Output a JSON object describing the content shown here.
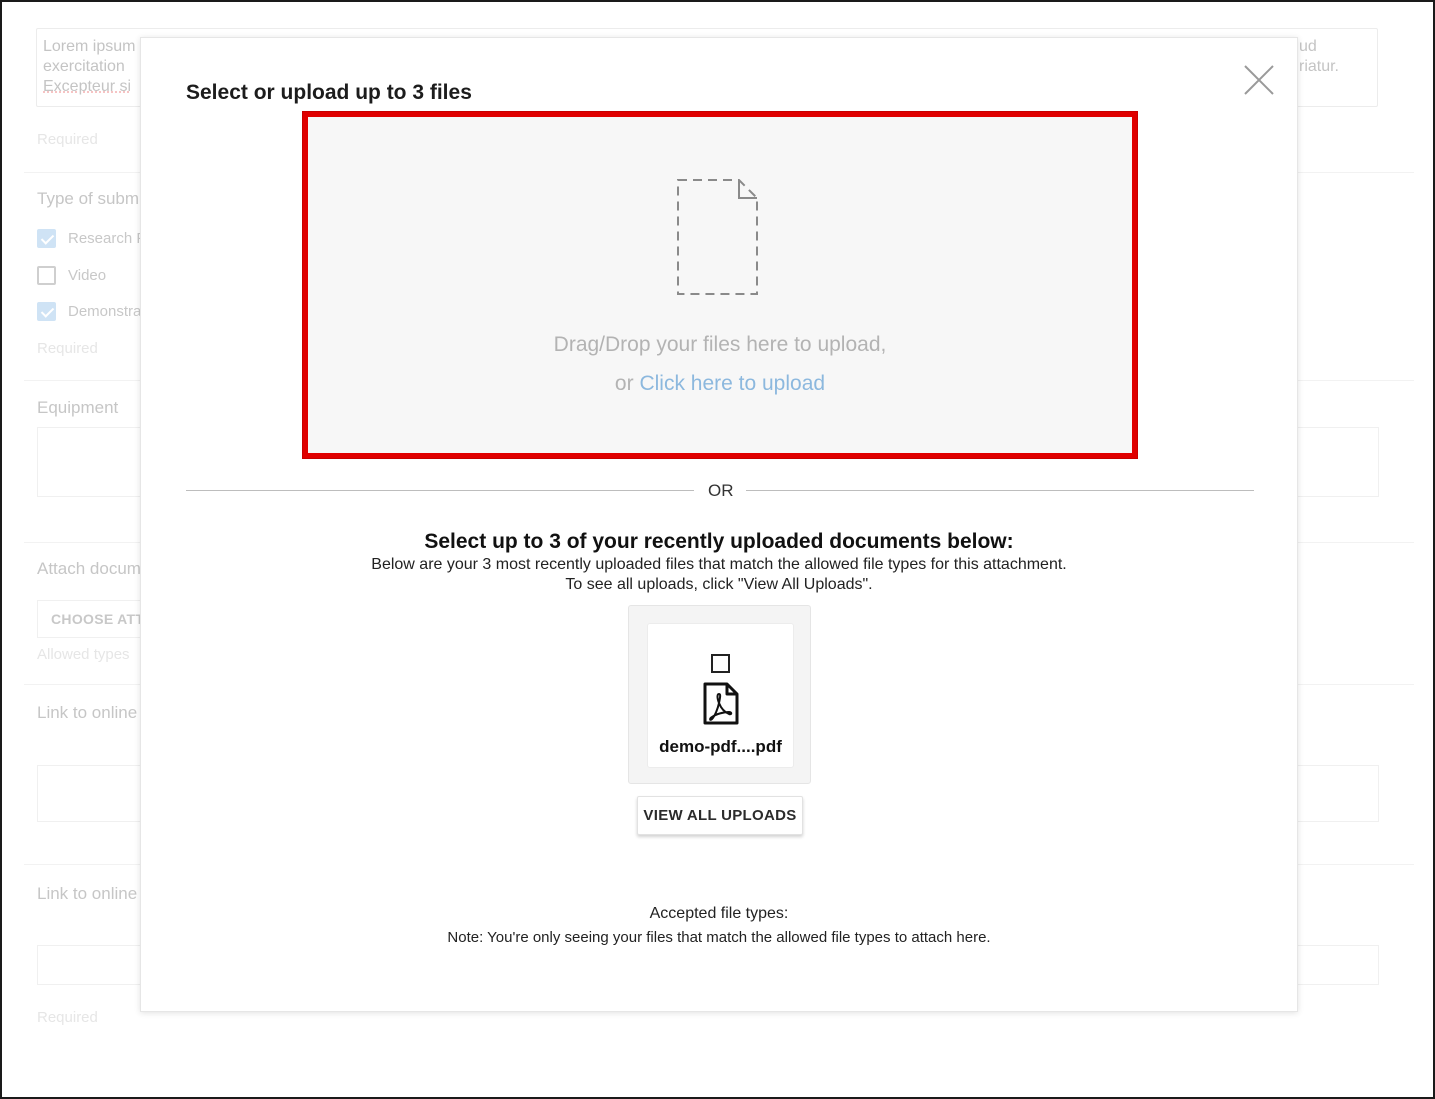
{
  "background_form": {
    "lorem_left_lines": [
      "Lorem ipsum",
      "exercitation",
      "Excepteur si"
    ],
    "lorem_right_lines": [
      "ud",
      "riatur."
    ],
    "required_label": "Required",
    "type_label": "Type of subm",
    "checkboxes": [
      {
        "label": "Research F",
        "checked": true
      },
      {
        "label": "Video",
        "checked": false
      },
      {
        "label": "Demonstra",
        "checked": true
      }
    ],
    "equipment_label": "Equipment",
    "attach_label": "Attach docum",
    "choose_button": "CHOOSE ATT",
    "allowed_types": "Allowed types",
    "link_label_1": "Link to online",
    "link_label_2": "Link to online"
  },
  "modal": {
    "title": "Select or upload up to 3 files",
    "dropzone": {
      "drag_text": "Drag/Drop your files here to upload,",
      "or_prefix": "or",
      "upload_link": "Click here to upload",
      "highlight_color": "#e00000"
    },
    "divider_text": "OR",
    "recent": {
      "title": "Select up to 3 of your recently uploaded documents below:",
      "subtitle_line1": "Below are your 3 most recently uploaded files that match the allowed file types for this attachment.",
      "subtitle_line2": "To see all uploads, click \"View All Uploads\".",
      "files": [
        {
          "name": "demo-pdf....pdf",
          "checked": false,
          "icon": "pdf-icon"
        }
      ],
      "view_all_button": "VIEW ALL UPLOADS"
    },
    "accepted_types_label": "Accepted file types:",
    "note": "Note: You're only seeing your files that match the allowed file types to attach here."
  }
}
